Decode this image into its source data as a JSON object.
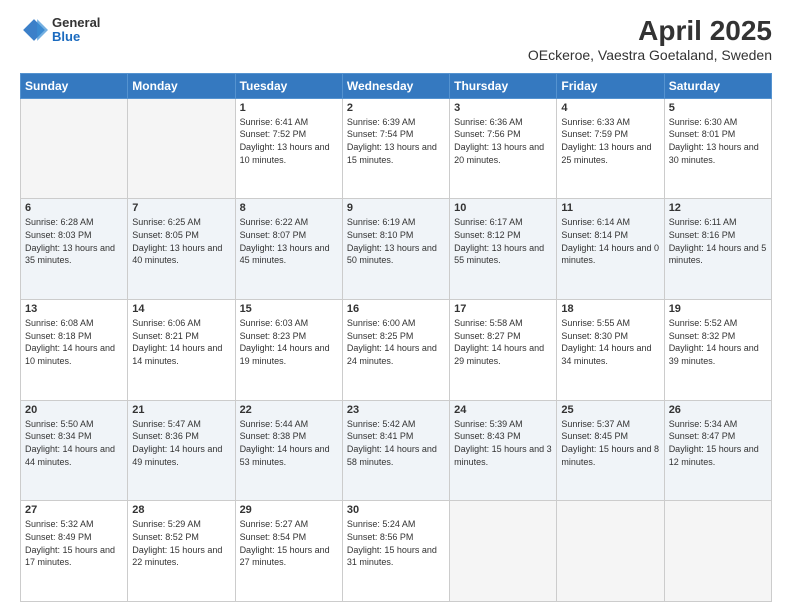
{
  "header": {
    "logo_general": "General",
    "logo_blue": "Blue",
    "title": "April 2025",
    "subtitle": "OEckeroe, Vaestra Goetaland, Sweden"
  },
  "days_of_week": [
    "Sunday",
    "Monday",
    "Tuesday",
    "Wednesday",
    "Thursday",
    "Friday",
    "Saturday"
  ],
  "weeks": [
    [
      {
        "day": "",
        "info": ""
      },
      {
        "day": "",
        "info": ""
      },
      {
        "day": "1",
        "info": "Sunrise: 6:41 AM\nSunset: 7:52 PM\nDaylight: 13 hours and 10 minutes."
      },
      {
        "day": "2",
        "info": "Sunrise: 6:39 AM\nSunset: 7:54 PM\nDaylight: 13 hours and 15 minutes."
      },
      {
        "day": "3",
        "info": "Sunrise: 6:36 AM\nSunset: 7:56 PM\nDaylight: 13 hours and 20 minutes."
      },
      {
        "day": "4",
        "info": "Sunrise: 6:33 AM\nSunset: 7:59 PM\nDaylight: 13 hours and 25 minutes."
      },
      {
        "day": "5",
        "info": "Sunrise: 6:30 AM\nSunset: 8:01 PM\nDaylight: 13 hours and 30 minutes."
      }
    ],
    [
      {
        "day": "6",
        "info": "Sunrise: 6:28 AM\nSunset: 8:03 PM\nDaylight: 13 hours and 35 minutes."
      },
      {
        "day": "7",
        "info": "Sunrise: 6:25 AM\nSunset: 8:05 PM\nDaylight: 13 hours and 40 minutes."
      },
      {
        "day": "8",
        "info": "Sunrise: 6:22 AM\nSunset: 8:07 PM\nDaylight: 13 hours and 45 minutes."
      },
      {
        "day": "9",
        "info": "Sunrise: 6:19 AM\nSunset: 8:10 PM\nDaylight: 13 hours and 50 minutes."
      },
      {
        "day": "10",
        "info": "Sunrise: 6:17 AM\nSunset: 8:12 PM\nDaylight: 13 hours and 55 minutes."
      },
      {
        "day": "11",
        "info": "Sunrise: 6:14 AM\nSunset: 8:14 PM\nDaylight: 14 hours and 0 minutes."
      },
      {
        "day": "12",
        "info": "Sunrise: 6:11 AM\nSunset: 8:16 PM\nDaylight: 14 hours and 5 minutes."
      }
    ],
    [
      {
        "day": "13",
        "info": "Sunrise: 6:08 AM\nSunset: 8:18 PM\nDaylight: 14 hours and 10 minutes."
      },
      {
        "day": "14",
        "info": "Sunrise: 6:06 AM\nSunset: 8:21 PM\nDaylight: 14 hours and 14 minutes."
      },
      {
        "day": "15",
        "info": "Sunrise: 6:03 AM\nSunset: 8:23 PM\nDaylight: 14 hours and 19 minutes."
      },
      {
        "day": "16",
        "info": "Sunrise: 6:00 AM\nSunset: 8:25 PM\nDaylight: 14 hours and 24 minutes."
      },
      {
        "day": "17",
        "info": "Sunrise: 5:58 AM\nSunset: 8:27 PM\nDaylight: 14 hours and 29 minutes."
      },
      {
        "day": "18",
        "info": "Sunrise: 5:55 AM\nSunset: 8:30 PM\nDaylight: 14 hours and 34 minutes."
      },
      {
        "day": "19",
        "info": "Sunrise: 5:52 AM\nSunset: 8:32 PM\nDaylight: 14 hours and 39 minutes."
      }
    ],
    [
      {
        "day": "20",
        "info": "Sunrise: 5:50 AM\nSunset: 8:34 PM\nDaylight: 14 hours and 44 minutes."
      },
      {
        "day": "21",
        "info": "Sunrise: 5:47 AM\nSunset: 8:36 PM\nDaylight: 14 hours and 49 minutes."
      },
      {
        "day": "22",
        "info": "Sunrise: 5:44 AM\nSunset: 8:38 PM\nDaylight: 14 hours and 53 minutes."
      },
      {
        "day": "23",
        "info": "Sunrise: 5:42 AM\nSunset: 8:41 PM\nDaylight: 14 hours and 58 minutes."
      },
      {
        "day": "24",
        "info": "Sunrise: 5:39 AM\nSunset: 8:43 PM\nDaylight: 15 hours and 3 minutes."
      },
      {
        "day": "25",
        "info": "Sunrise: 5:37 AM\nSunset: 8:45 PM\nDaylight: 15 hours and 8 minutes."
      },
      {
        "day": "26",
        "info": "Sunrise: 5:34 AM\nSunset: 8:47 PM\nDaylight: 15 hours and 12 minutes."
      }
    ],
    [
      {
        "day": "27",
        "info": "Sunrise: 5:32 AM\nSunset: 8:49 PM\nDaylight: 15 hours and 17 minutes."
      },
      {
        "day": "28",
        "info": "Sunrise: 5:29 AM\nSunset: 8:52 PM\nDaylight: 15 hours and 22 minutes."
      },
      {
        "day": "29",
        "info": "Sunrise: 5:27 AM\nSunset: 8:54 PM\nDaylight: 15 hours and 27 minutes."
      },
      {
        "day": "30",
        "info": "Sunrise: 5:24 AM\nSunset: 8:56 PM\nDaylight: 15 hours and 31 minutes."
      },
      {
        "day": "",
        "info": ""
      },
      {
        "day": "",
        "info": ""
      },
      {
        "day": "",
        "info": ""
      }
    ]
  ]
}
